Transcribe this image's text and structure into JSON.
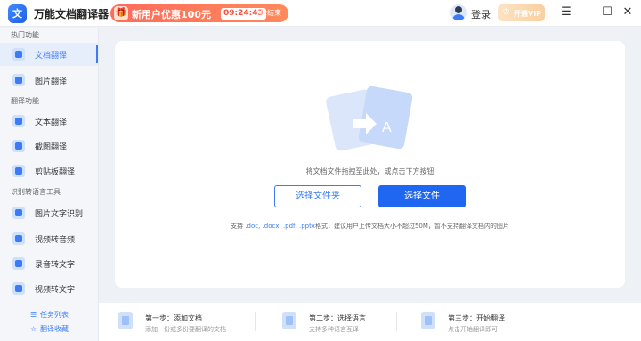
{
  "app": {
    "logo_glyph": "文",
    "title": "万能文档翻译器"
  },
  "promo": {
    "gift_glyph": "🎁",
    "text": "新用户优惠100元",
    "timer": "09:24:43",
    "end_label": "后结束"
  },
  "header": {
    "login_label": "登录",
    "vip_label": "开通VIP",
    "vip_icon": "♔"
  },
  "window_controls": {
    "menu": "☰",
    "minimize": "—",
    "maximize": "☐",
    "close": "✕"
  },
  "sidebar": {
    "sections": [
      "热门功能",
      "翻译功能",
      "识别转语言工具"
    ],
    "items": [
      {
        "label": "文档翻译",
        "icon": "document-translate-icon"
      },
      {
        "label": "图片翻译",
        "icon": "image-translate-icon"
      },
      {
        "label": "文本翻译",
        "icon": "text-translate-icon"
      },
      {
        "label": "截图翻译",
        "icon": "screenshot-translate-icon"
      },
      {
        "label": "剪贴板翻译",
        "icon": "clipboard-translate-icon"
      },
      {
        "label": "图片文字识别",
        "icon": "ocr-icon"
      },
      {
        "label": "视频转音频",
        "icon": "video-to-audio-icon"
      },
      {
        "label": "录音转文字",
        "icon": "audio-to-text-icon"
      },
      {
        "label": "视频转文字",
        "icon": "video-to-text-icon"
      }
    ],
    "bottom_links": [
      {
        "label": "任务列表",
        "icon": "☰"
      },
      {
        "label": "翻译收藏",
        "icon": "☆"
      }
    ]
  },
  "upload": {
    "hint": "将文档文件拖拽至此处，或点击下方按钮",
    "select_folder_label": "选择文件夹",
    "select_file_label": "选择文件",
    "support_prefix": "支持",
    "support_formats": ".doc, .docx, .pdf, .pptx",
    "support_suffix": "格式，建议用户上传文档大小不超过50M，暂不支持翻译文档内的图片"
  },
  "steps": [
    {
      "title": "第一步：添加文档",
      "desc": "添加一份或多份要翻译的文档"
    },
    {
      "title": "第二步：选择语言",
      "desc": "支持多种语言互译"
    },
    {
      "title": "第三步：开始翻译",
      "desc": "点击开始翻译即可"
    }
  ],
  "colors": {
    "accent": "#1f66f0",
    "promo": "#ff6a5a",
    "vip": "#f9cfa0"
  }
}
